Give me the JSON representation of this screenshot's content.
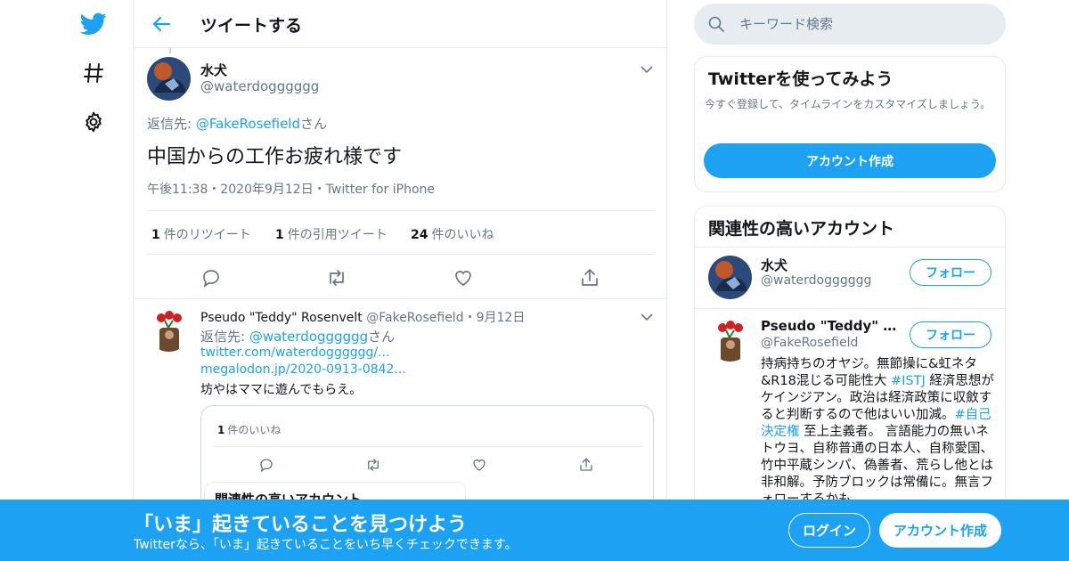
{
  "colors": {
    "accent": "#1da1f2",
    "text": "#14171a",
    "secondary": "#657786",
    "border": "#e6ecf0"
  },
  "nav": {
    "items": [
      "twitter-logo-icon",
      "hashtag-icon",
      "gear-icon"
    ]
  },
  "header": {
    "title": "ツイートする"
  },
  "tweet": {
    "name": "水犬",
    "handle": "@waterdogggggg",
    "reply_prefix": "返信先: ",
    "reply_to": "@FakeRosefield",
    "reply_suffix": "さん",
    "text": "中国からの工作お疲れ様です",
    "meta": "午後11:38・2020年9月12日・Twitter for iPhone",
    "stats": [
      {
        "count": "1",
        "label": "件のリツイート"
      },
      {
        "count": "1",
        "label": "件の引用ツイート"
      },
      {
        "count": "24",
        "label": "件のいいね"
      }
    ]
  },
  "reply": {
    "name": "Pseudo \"Teddy\" Rosenvelt",
    "handle": "@FakeRosefield",
    "date": "・9月12日",
    "reply_prefix": "返信先: ",
    "reply_to": "@waterdogggggg",
    "reply_suffix": "さん",
    "link1": "twitter.com/waterdogggggg/...",
    "link2": "megalodon.jp/2020-0913-0842...",
    "text": "坊やはママに遊んでもらえ。",
    "embed": {
      "like_count": "1",
      "like_label": "件のいいね",
      "card_title": "関連性の高いアカウント"
    }
  },
  "search": {
    "placeholder": "キーワード検索"
  },
  "signup_card": {
    "title": "Twitterを使ってみよう",
    "desc": "今すぐ登録して、タイムラインをカスタマイズしましょう。",
    "button": "アカウント作成"
  },
  "related": {
    "title": "関連性の高いアカウント",
    "accounts": [
      {
        "name": "水犬",
        "handle": "@waterdogggggg",
        "follow": "フォロー"
      },
      {
        "name": "Pseudo \"Teddy\" Rose...",
        "handle": "@FakeRosefield",
        "follow": "フォロー"
      }
    ],
    "bio_1": "持病持ちのオヤジ。無節操に&虹ネタ&R18混じる可能性大 ",
    "bio_tag1": "#ISTJ",
    "bio_2": " 経済思想がケインジアン。政治は経済政策に収斂すると判断するので他はいい加減。",
    "bio_tag2": "#自己決定権",
    "bio_3": " 至上主義者。 言語能力の無いネトウヨ、自称普通の日本人、自称愛国、竹中平蔵シンパ、偽善者、荒らし他とは非和解。予防ブロックは常備に。無言フォローするかも"
  },
  "bottom_bar": {
    "title": "「いま」起きていることを見つけよう",
    "subtitle": "Twitterなら、「いま」起きていることをいち早くチェックできます。",
    "login": "ログイン",
    "signup": "アカウント作成"
  }
}
